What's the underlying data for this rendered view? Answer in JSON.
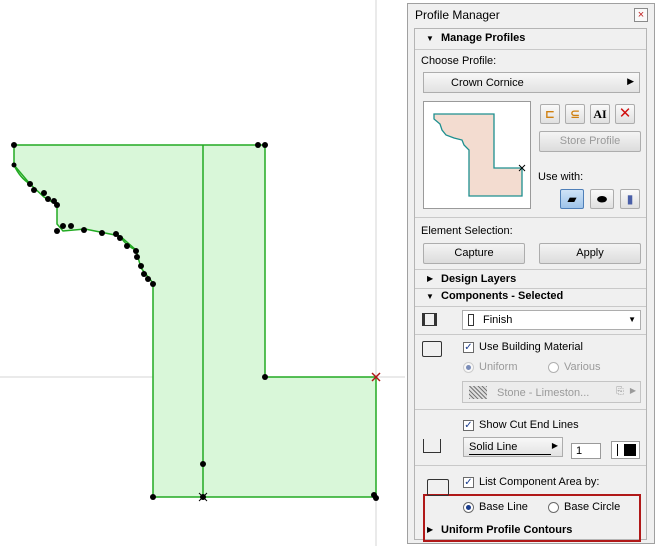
{
  "panel": {
    "title": "Profile Manager",
    "close_glyph": "×",
    "manage_profiles": "Manage Profiles",
    "choose_profile_label": "Choose Profile:",
    "profile_selected": "Crown Cornice",
    "store_profile": "Store Profile",
    "use_with_label": "Use with:",
    "element_selection_label": "Element Selection:",
    "capture": "Capture",
    "apply": "Apply",
    "design_layers": "Design Layers",
    "components_selected": "Components - Selected",
    "finish_value": "Finish",
    "use_building_material": "Use Building Material",
    "uniform": "Uniform",
    "various": "Various",
    "material_value": "Stone - Limeston...",
    "show_cut_end_lines": "Show Cut End Lines",
    "line_type": "Solid Line",
    "pen_number": "1",
    "list_component_area_by": "List Component Area by:",
    "base_line": "Base Line",
    "base_circle": "Base Circle",
    "uniform_profile_contours": "Uniform Profile Contours"
  },
  "icons": {
    "new_profile": "new-profile-icon",
    "duplicate_profile": "duplicate-profile-icon",
    "rename_profile": "rename-profile-icon",
    "delete_profile": "delete-profile-icon",
    "use_wall": "wall-icon",
    "use_beam": "beam-icon",
    "use_column": "column-icon"
  },
  "colors": {
    "profile_fill": "#d9f7d9",
    "profile_stroke": "#22aa22",
    "highlight_box": "#b01818"
  }
}
